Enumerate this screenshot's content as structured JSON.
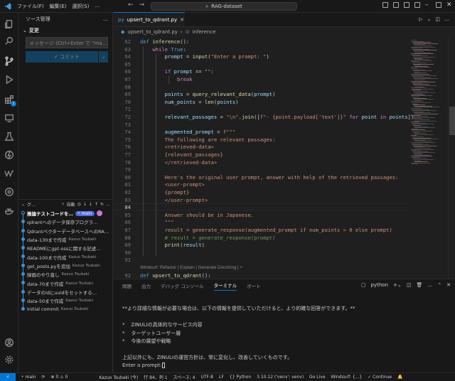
{
  "titlebar": {
    "menu": [
      "ファイル(F)",
      "編集(E)",
      "選択(S)",
      "…"
    ],
    "search": "RAG-dataset",
    "back": "←",
    "forward": "→"
  },
  "activity_badge": "1",
  "sidebar": {
    "title": "ソース管理",
    "more": "…",
    "section": "変更",
    "message_placeholder": "メッセージ (Ctrl+Enter で \"ma...",
    "commit_label": "✓ コミット",
    "graph_title": "グ…",
    "graph_auto": "自動",
    "commits": [
      {
        "msg": "推論テストコードを…",
        "author": "",
        "branch": "main"
      },
      {
        "msg": "qdrantへのデータ保存プログラ…",
        "author": ""
      },
      {
        "msg": "QdrantベクターデータベースへのRA…",
        "author": ""
      },
      {
        "msg": "data-130まで作成",
        "author": "Kazuo Tsubaki"
      },
      {
        "msg": "READMEにgpt-ossに関する記述…",
        "author": ""
      },
      {
        "msg": "data-100まで作成",
        "author": "Kazuo Tsubaki"
      },
      {
        "msg": "get_posts.pyを追加",
        "author": "Kazuo Tsubaki"
      },
      {
        "msg": "録画のやり直し",
        "author": "Kazuo Tsubaki"
      },
      {
        "msg": "data-70まで作成",
        "author": "Kazuo Tsubaki"
      },
      {
        "msg": "データのidにuuidをセットする…",
        "author": ""
      },
      {
        "msg": "data-50まで作成",
        "author": "Kazuo Tsubaki"
      },
      {
        "msg": "Initial commit",
        "author": "Kazuo Tsubaki"
      }
    ]
  },
  "editor": {
    "tab": "upsert_to_qdrant.py",
    "tab_icon": "py",
    "breadcrumb_file": "upsert_to_qdrant.py",
    "breadcrumb_symbol": "inference",
    "lines": [
      {
        "n": "62",
        "t": "def inference():"
      },
      {
        "n": "63",
        "t": "    while True:"
      },
      {
        "n": "64",
        "t": "        prompt = input(\"Enter a prompt: \")"
      },
      {
        "n": "65",
        "t": ""
      },
      {
        "n": "66",
        "t": "        if prompt == \"\":"
      },
      {
        "n": "67",
        "t": "            break"
      },
      {
        "n": "68",
        "t": ""
      },
      {
        "n": "69",
        "t": "        points = query_relevant_data(prompt)"
      },
      {
        "n": "70",
        "t": "        num_points = len(points)"
      },
      {
        "n": "71",
        "t": ""
      },
      {
        "n": "72",
        "t": "        relevant_passages = \"\\n\".join([f\"- {point.payload['text']}\" for point in points])"
      },
      {
        "n": "73",
        "t": ""
      },
      {
        "n": "74",
        "t": "        augmented_prompt = f\"\"\""
      },
      {
        "n": "75",
        "t": "        The following are relevant passages:"
      },
      {
        "n": "76",
        "t": "        <retrieved-data>"
      },
      {
        "n": "77",
        "t": "        {relevant_passages}"
      },
      {
        "n": "78",
        "t": "        </retrieved-data>"
      },
      {
        "n": "79",
        "t": ""
      },
      {
        "n": "80",
        "t": "        Here's the original user prompt, answer with help of the retrieved passages:"
      },
      {
        "n": "81",
        "t": "        <user-prompt>"
      },
      {
        "n": "82",
        "t": "        {prompt}"
      },
      {
        "n": "83",
        "t": "        </user-prompt>"
      },
      {
        "n": "84",
        "t": ""
      },
      {
        "n": "85",
        "t": "        Answer should be in Japanese."
      },
      {
        "n": "86",
        "t": "        \"\"\""
      },
      {
        "n": "87",
        "t": "        result = generate_response(augmented_prompt if num_points > 0 else prompt)"
      },
      {
        "n": "88",
        "t": "        # result = generate_response(prompt)"
      },
      {
        "n": "89",
        "t": "        print(result)"
      },
      {
        "n": "90",
        "t": ""
      },
      {
        "n": "91",
        "t": ""
      },
      {
        "n": "92",
        "t": "def upsert_to_qdrant():"
      }
    ],
    "codelens": "Windsurf: Refactor | Explain | Generate Docstring | ×"
  },
  "panel": {
    "tabs": [
      "問題",
      "出力",
      "デバッグ コンソール",
      "ターミナル",
      "ポート"
    ],
    "active": 3,
    "shell": "python",
    "lines": [
      "**より詳細な情報が必要な場合は、以下の情報を提供していただけると、より的確な回答ができます。**",
      "",
      "*    ZINULIの具体的なサービス内容",
      "*    ターゲットユーザー層",
      "*    今後の展望や戦略",
      "",
      "上記以外にも、ZINULIの運営方針は、常に変化し、改善していくものです。",
      "Enter a prompt: "
    ]
  },
  "status": {
    "branch": "main",
    "sync": "⟳",
    "problems": "⊗ 0 ⚠ 0",
    "author": "Kazuo Tsubaki (今)",
    "pos": "行 84、列 1",
    "spaces": "スペース: 4",
    "enc": "UTF-8",
    "eol": "LF",
    "lang": "{} Python",
    "py": "3.10.12 ('venv': venv)",
    "golive": "Go Live",
    "windsurf": "Windsurf: {...}",
    "cont": "✓ Continue"
  }
}
